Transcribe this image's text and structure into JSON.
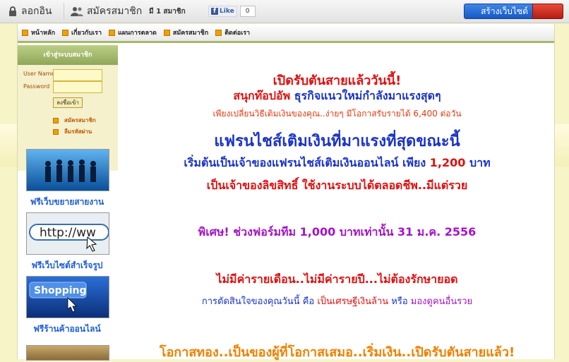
{
  "topbar": {
    "login": "ลอกอิน",
    "register": "สมัครสมาชิก",
    "members": "มี 1 สมาชิก",
    "like_label": "Like",
    "like_count": "0",
    "create_site": "สร้างเว็บไซต์"
  },
  "nav": {
    "items": [
      "หน้าหลัก",
      "เกี่ยวกับเรา",
      "แผนการตลาด",
      "สมัครสมาชิก",
      "ติดต่อเรา"
    ]
  },
  "sidebar": {
    "login_title": "เข้าสู่ระบบสมาชิก",
    "username_label": "User Name",
    "password_label": "Password",
    "login_button": "ลงชื่อเข้า",
    "links": [
      "สมัครสมาชิก",
      "ลืมรหัสผ่าน"
    ],
    "promos": [
      {
        "caption": "ฟรีเว็บขยายสายงาน",
        "icon": "team-icon"
      },
      {
        "caption": "ฟรีเว็บไซต์สำเร็จรูป",
        "icon": "http-icon"
      },
      {
        "caption": "ฟรีร้านค้าออนไลน์",
        "icon": "shopping-icon"
      }
    ]
  },
  "main": {
    "line1": "เปิดรับตันสายแล้ววันนี้!",
    "line2a": "สนุกท๊อปอัพ ",
    "line2b": "ธุรกิจแนวใหม่กำลังมาแรงสุดๆ",
    "line3": "เพียงเปลี่ยนวิธีเติมเงินของคุณ..ง่ายๆ มีโอกาสรับรายได้ 6,400 ต่อวัน",
    "line4": "แฟรนไชส์เติมเงินที่มาแรงที่สุดขณะนี้",
    "line5a": "เริ่มต้นเป็นเจ้าของแฟรนไชส์เติมเงินออนไลน์ เพียง ",
    "line5b": "1,200",
    "line5c": " บาท",
    "line6": "เป็นเจ้าของลิขสิทธิ์ ใช้งานระบบได้ตลอดชีพ..มีแต่รวย",
    "line7": "พิเศษ! ช่วงฟอร์มทีม  1,000 บาทเท่านั้น 31 ม.ค. 2556",
    "line8": "ไม่มีค่ารายเดือน..ไม่มีค่ารายปี...ไม่ต้องรักษายอด",
    "line9a": "การตัดสินใจของคุณวันนี้ คือ ",
    "line9b": "เป็นเศรษฐีเงินล้าน",
    "line9c": " หรือ ",
    "line9d": "มองดูคนอื่นรวย",
    "line10": "โอกาสทอง..เป็นของผู้ที่โอกาสเสมอ..เริ่มเงิน..เปิดรับตันสายแล้ว!"
  },
  "colors": {
    "red": "#e01010",
    "blue": "#1a33c8",
    "purple": "#a414c8",
    "orange": "#f08000"
  }
}
